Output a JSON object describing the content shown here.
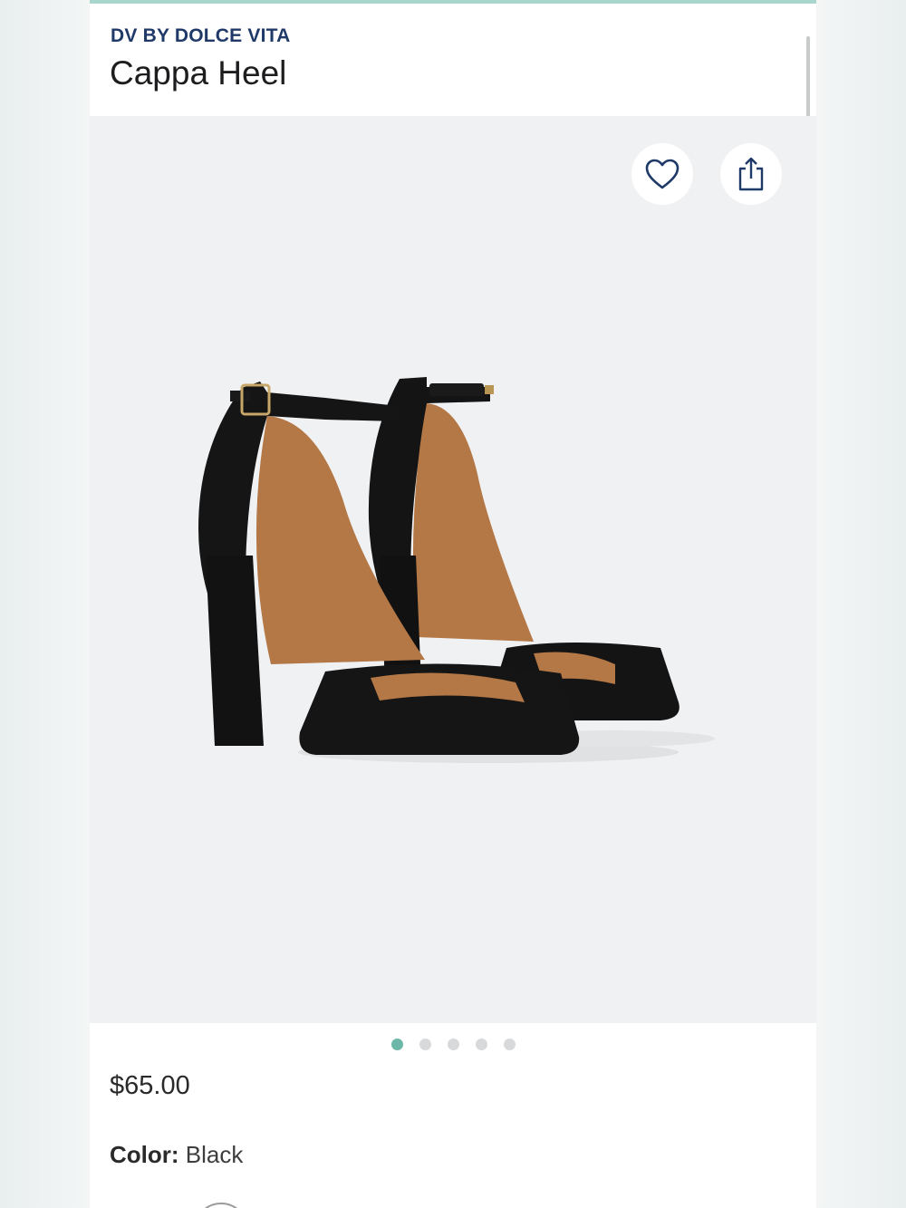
{
  "product": {
    "brand": "DV BY DOLCE VITA",
    "name": "Cappa Heel",
    "price": "$65.00"
  },
  "actions": {
    "favorite_icon": "heart-icon",
    "share_icon": "share-icon"
  },
  "gallery": {
    "image_alt": "Black block heel sandal with ankle strap",
    "image_count": 5,
    "active_index": 0
  },
  "color": {
    "label": "Color:",
    "value": "Black"
  },
  "colors": {
    "brand": "#1f3a68",
    "active_dot": "#6db7a9",
    "accent_bar": "#a8d5cc"
  }
}
